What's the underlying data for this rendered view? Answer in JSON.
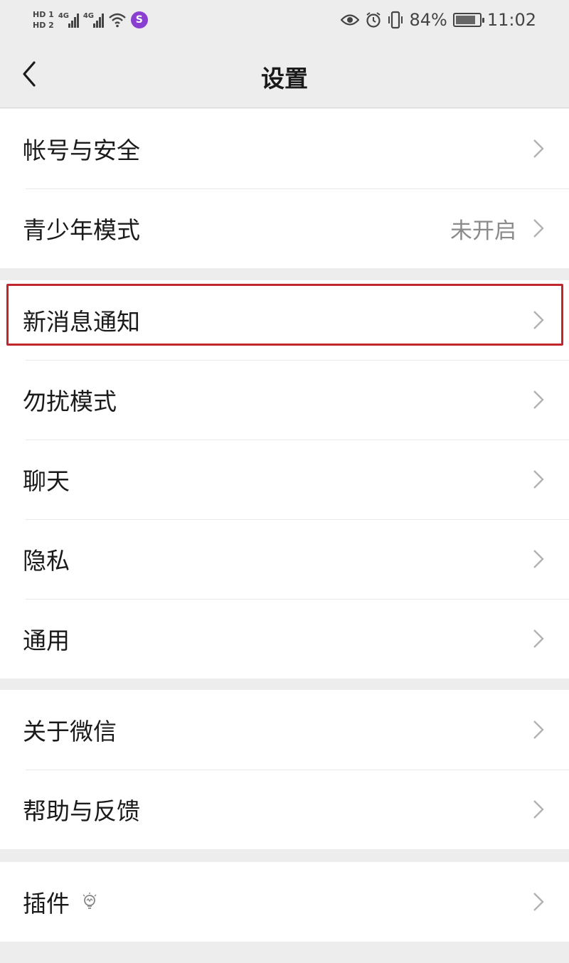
{
  "status_bar": {
    "hd1": "HD 1",
    "hd2": "HD 2",
    "signal1_label": "4G",
    "signal2_label": "4G",
    "app_badge": "S",
    "battery_percent": "84%",
    "battery_level": 0.84,
    "time": "11:02",
    "icons": [
      "eye-icon",
      "alarm-icon",
      "vibrate-icon"
    ]
  },
  "nav": {
    "title": "设置"
  },
  "groups": [
    {
      "items": [
        {
          "label": "帐号与安全",
          "value": ""
        },
        {
          "label": "青少年模式",
          "value": "未开启"
        }
      ]
    },
    {
      "items": [
        {
          "label": "新消息通知",
          "value": ""
        },
        {
          "label": "勿扰模式",
          "value": ""
        },
        {
          "label": "聊天",
          "value": ""
        },
        {
          "label": "隐私",
          "value": ""
        },
        {
          "label": "通用",
          "value": ""
        }
      ]
    },
    {
      "items": [
        {
          "label": "关于微信",
          "value": ""
        },
        {
          "label": "帮助与反馈",
          "value": ""
        }
      ]
    },
    {
      "items": [
        {
          "label": "插件",
          "value": "",
          "icon": "lightbulb-icon"
        }
      ]
    }
  ],
  "colors": {
    "background": "#ededed",
    "highlight_border": "#c0262c",
    "value_text": "#8a8a8a"
  }
}
